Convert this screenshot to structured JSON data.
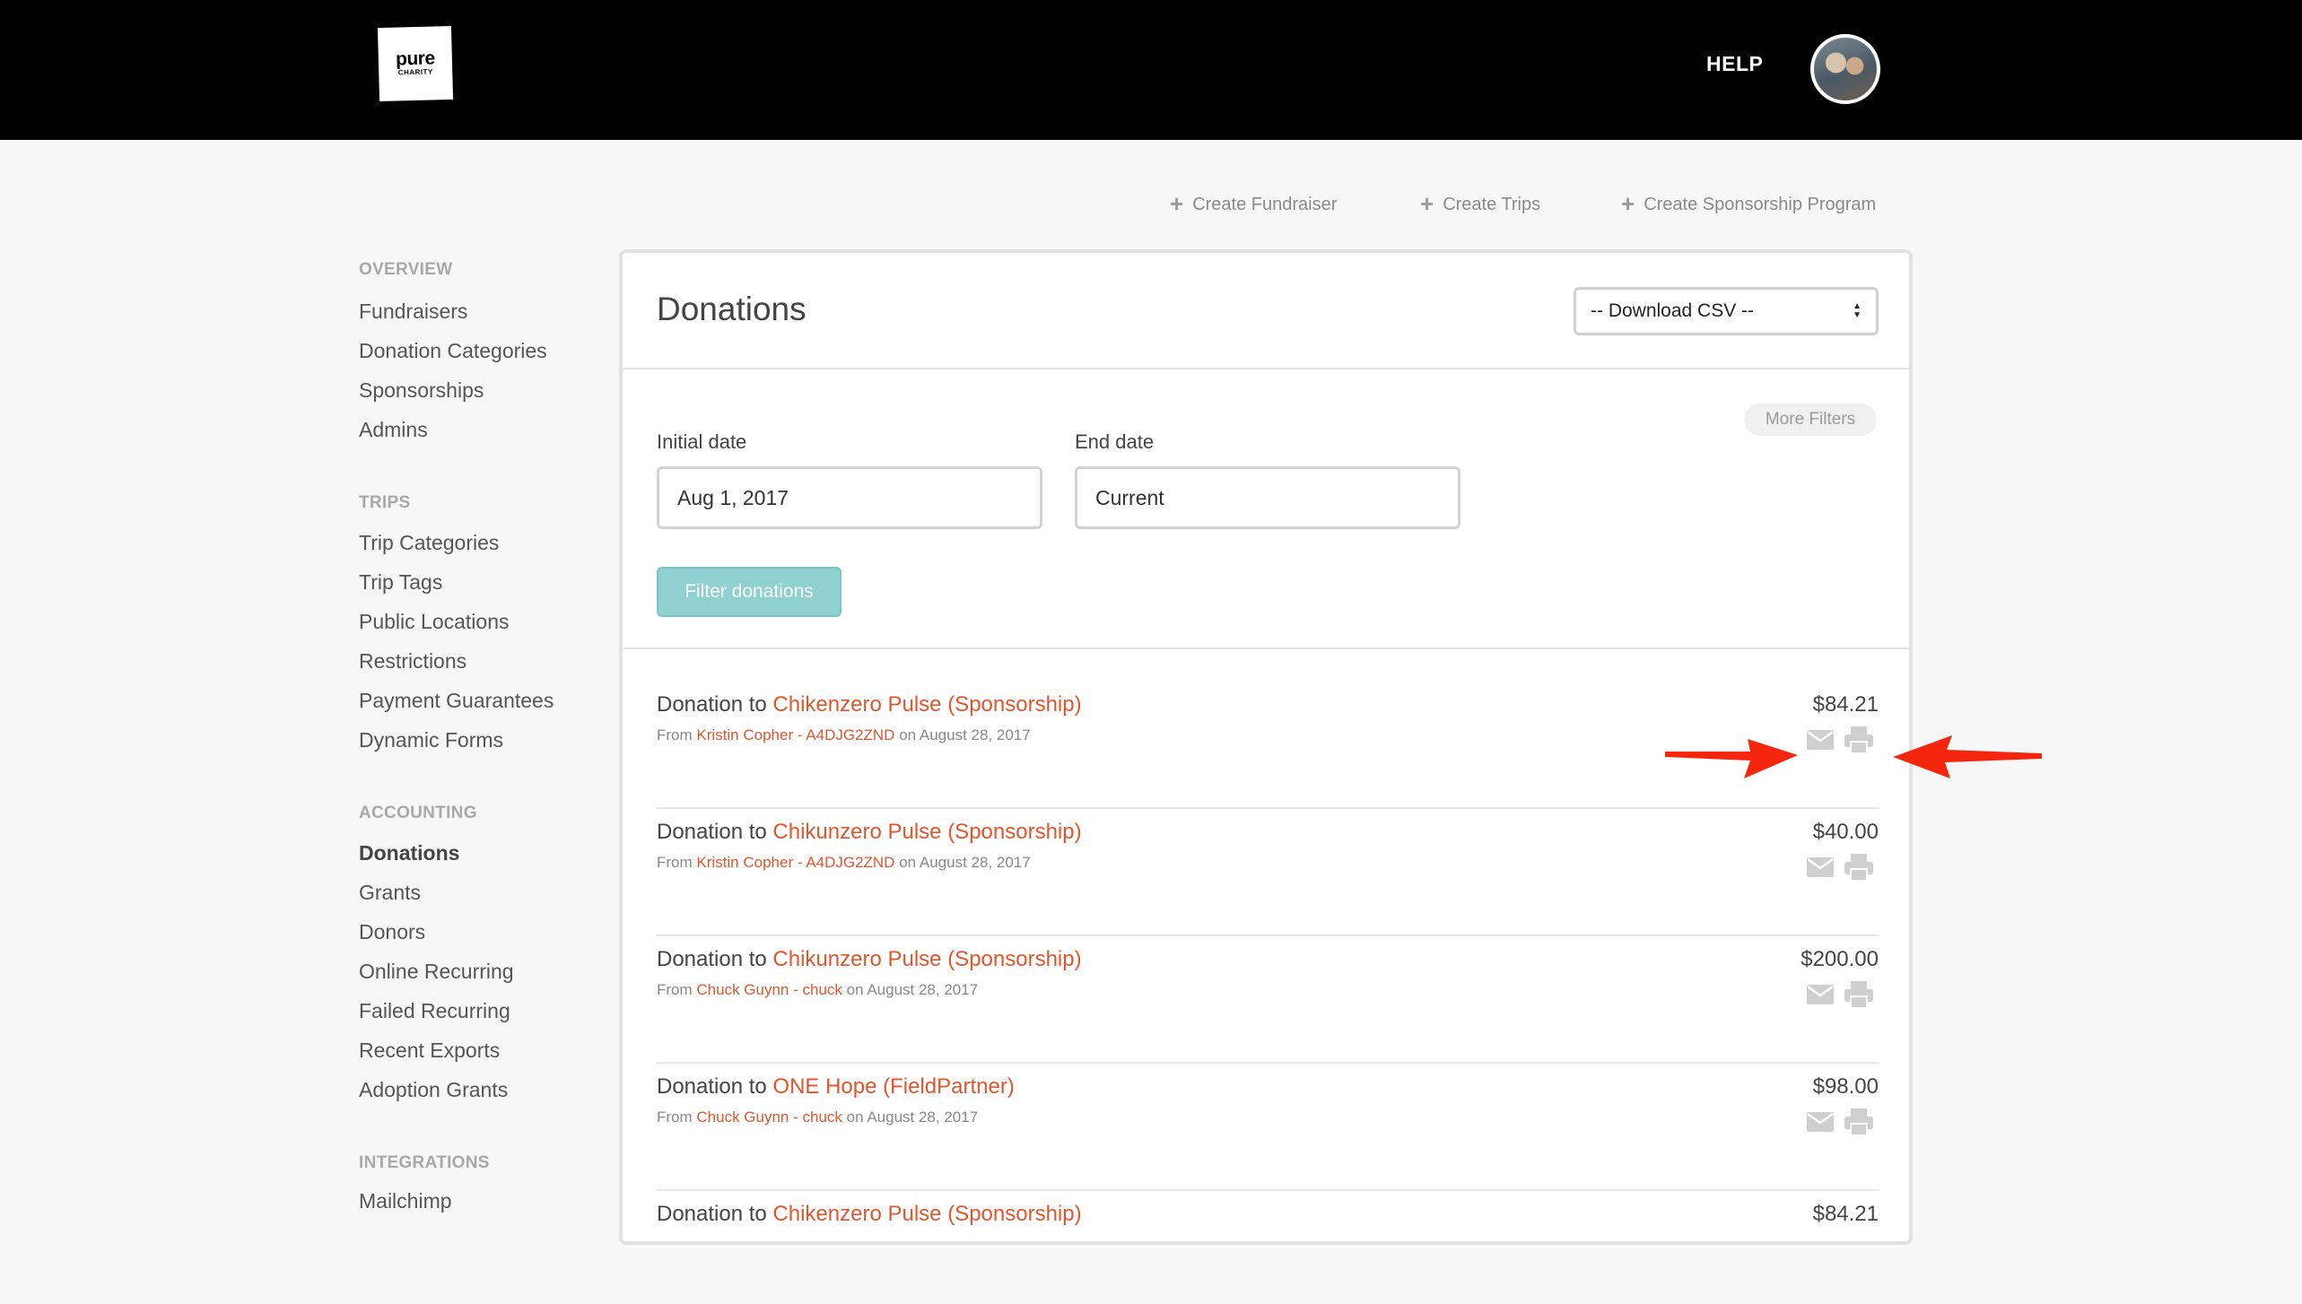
{
  "header": {
    "logo_line1": "pure",
    "logo_line2": "CHARITY",
    "help": "HELP"
  },
  "actions": [
    {
      "label": "Create Fundraiser"
    },
    {
      "label": "Create Trips"
    },
    {
      "label": "Create Sponsorship Program"
    }
  ],
  "sidebar": {
    "sections": [
      {
        "heading": "OVERVIEW",
        "items": [
          "Fundraisers",
          "Donation Categories",
          "Sponsorships",
          "Admins"
        ]
      },
      {
        "heading": "TRIPS",
        "items": [
          "Trip Categories",
          "Trip Tags",
          "Public Locations",
          "Restrictions",
          "Payment Guarantees",
          "Dynamic Forms"
        ]
      },
      {
        "heading": "ACCOUNTING",
        "items": [
          "Donations",
          "Grants",
          "Donors",
          "Online Recurring",
          "Failed Recurring",
          "Recent Exports",
          "Adoption Grants"
        ]
      },
      {
        "heading": "INTEGRATIONS",
        "items": [
          "Mailchimp"
        ]
      }
    ],
    "active": "Donations"
  },
  "panel": {
    "title": "Donations",
    "csv_select": "-- Download CSV --",
    "more_filters": "More Filters",
    "initial_date_label": "Initial date",
    "initial_date_value": "Aug 1, 2017",
    "end_date_label": "End date",
    "end_date_value": "Current",
    "filter_button": "Filter donations"
  },
  "donations": [
    {
      "prefix": "Donation to ",
      "target": "Chikenzero Pulse (Sponsorship)",
      "from": "From ",
      "donor": "Kristin Copher - A4DJG2ZND",
      "date": " on August 28, 2017",
      "amount": "$84.21"
    },
    {
      "prefix": "Donation to ",
      "target": "Chikunzero Pulse (Sponsorship)",
      "from": "From ",
      "donor": "Kristin Copher - A4DJG2ZND",
      "date": " on August 28, 2017",
      "amount": "$40.00"
    },
    {
      "prefix": "Donation to ",
      "target": "Chikunzero Pulse (Sponsorship)",
      "from": "From ",
      "donor": "Chuck Guynn - chuck",
      "date": " on August 28, 2017",
      "amount": "$200.00"
    },
    {
      "prefix": "Donation to ",
      "target": "ONE Hope (FieldPartner)",
      "from": "From ",
      "donor": "Chuck Guynn - chuck",
      "date": " on August 28, 2017",
      "amount": "$98.00"
    },
    {
      "prefix": "Donation to ",
      "target": "Chikenzero Pulse (Sponsorship)",
      "from": "",
      "donor": "",
      "date": "",
      "amount": "$84.21"
    }
  ],
  "colors": {
    "accent_link": "#e0562d",
    "filter_button": "#8fd1d1",
    "annotation_arrow": "#f5260e"
  },
  "icons": [
    "plus-icon",
    "envelope-icon",
    "printer-icon",
    "select-arrows-icon"
  ]
}
